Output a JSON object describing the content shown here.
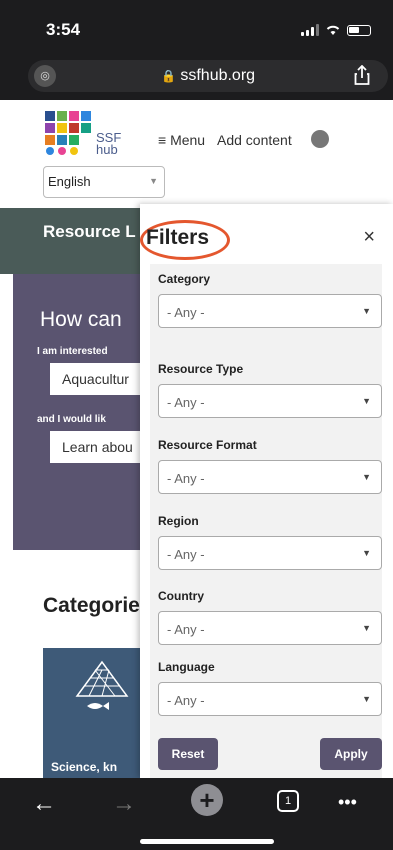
{
  "status_bar": {
    "time": "3:54"
  },
  "browser": {
    "url": "ssfhub.org"
  },
  "site": {
    "logo_text_line1": "SSF",
    "logo_text_line2": "hub",
    "menu_label": "Menu",
    "add_content_label": "Add content",
    "language_value": "English"
  },
  "hero": {
    "title": "Resource L",
    "question": "How can",
    "interested_label": "I am interested",
    "interested_value": "Aquacultur",
    "would_like_label": "and I would lik",
    "would_like_value": "Learn abou"
  },
  "categories": {
    "title": "Categorie",
    "card_label": "Science, kn"
  },
  "filters": {
    "title": "Filters",
    "close_glyph": "×",
    "fields": [
      {
        "label": "Category",
        "value": "- Any -"
      },
      {
        "label": "Resource Type",
        "value": "- Any -"
      },
      {
        "label": "Resource Format",
        "value": "- Any -"
      },
      {
        "label": "Region",
        "value": "- Any -"
      },
      {
        "label": "Country",
        "value": "- Any -"
      },
      {
        "label": "Language",
        "value": "- Any -"
      }
    ],
    "reset_label": "Reset",
    "apply_label": "Apply"
  },
  "toolbar": {
    "back_icon": "←",
    "forward_icon": "→",
    "new_tab_icon": "+",
    "tab_count": "1",
    "more_icon": "•••"
  },
  "colors": {
    "accent_purple": "#5a5470",
    "highlight_circle": "#e4572e"
  }
}
